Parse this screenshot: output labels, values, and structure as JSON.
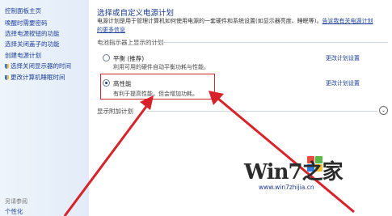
{
  "sidebar": {
    "home": "控制面板主页",
    "links": [
      "唤醒时需要密码",
      "选择电源按钮的功能",
      "选择关闭盖子的功能",
      "创建电源计划",
      "选择关闭显示器的时间",
      "更改计算机睡眠时间"
    ],
    "footer": [
      "另请参阅",
      "个性化"
    ]
  },
  "main": {
    "title": "选择或自定义电源计划",
    "description": "电源计划是用于管理计算机如何使用电源的一套硬件和系统设置(如显示器亮度、睡眠等)。",
    "description_link": "告诉我有关电源计划",
    "description_link2": "的更多信息",
    "section_label": "电池指示器上显示的计划",
    "plans": [
      {
        "name": "平衡 (推荐)",
        "desc": "利用可用的硬件自动平衡功耗与性能。",
        "selected": false,
        "change": "更改计划设置"
      },
      {
        "name": "高性能",
        "desc": "有利于提高性能，但会增加功耗。",
        "selected": true,
        "change": "更改计划设置"
      }
    ],
    "more_plans": "显示附加计划",
    "expand_glyph": "⌄"
  },
  "watermark": {
    "text": "Win7之家",
    "url": "www.win7zhijia.cn"
  },
  "colors": {
    "highlight": "#d8232a",
    "link": "#1d3f9a"
  }
}
